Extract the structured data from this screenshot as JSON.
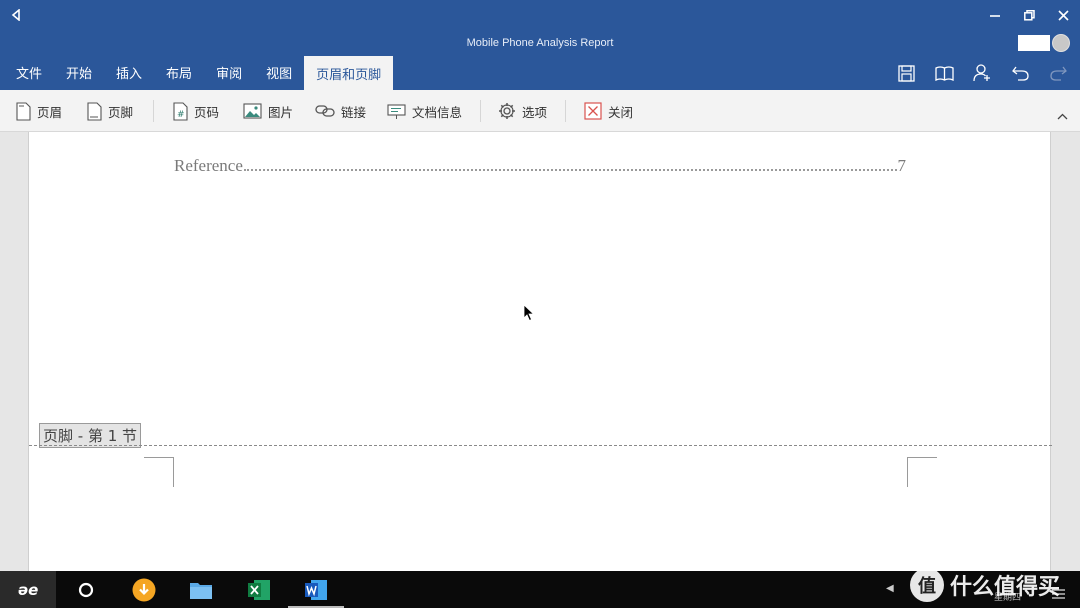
{
  "window": {
    "title": "Mobile Phone Analysis Report",
    "accent": "#2b579a"
  },
  "ribbon": {
    "tabs": [
      {
        "label": "文件"
      },
      {
        "label": "开始"
      },
      {
        "label": "插入"
      },
      {
        "label": "布局"
      },
      {
        "label": "审阅"
      },
      {
        "label": "视图"
      },
      {
        "label": "页眉和页脚",
        "active": true
      }
    ],
    "quick_icons": [
      "save-icon",
      "read-mode-icon",
      "share-user-icon",
      "undo-icon",
      "redo-icon"
    ],
    "commands": [
      {
        "label": "页眉",
        "icon": "header-page-icon"
      },
      {
        "label": "页脚",
        "icon": "footer-page-icon"
      },
      {
        "label": "页码",
        "icon": "page-number-icon"
      },
      {
        "label": "图片",
        "icon": "picture-icon"
      },
      {
        "label": "链接",
        "icon": "link-icon"
      },
      {
        "label": "文档信息",
        "icon": "document-info-icon"
      },
      {
        "label": "选项",
        "icon": "gear-icon"
      },
      {
        "label": "关闭",
        "icon": "close-red-icon"
      }
    ]
  },
  "document": {
    "toc_entry": {
      "text": "Reference",
      "page": "7"
    },
    "footer_label": "页脚 - 第 1 节"
  },
  "taskbar": {
    "apps": [
      "start-logo-icon",
      "search-circle-icon",
      "download-icon",
      "folder-icon",
      "excel-icon",
      "word-icon"
    ],
    "tray_day": "星期四"
  },
  "watermark": {
    "text": "什么值得买",
    "logo": "值"
  }
}
